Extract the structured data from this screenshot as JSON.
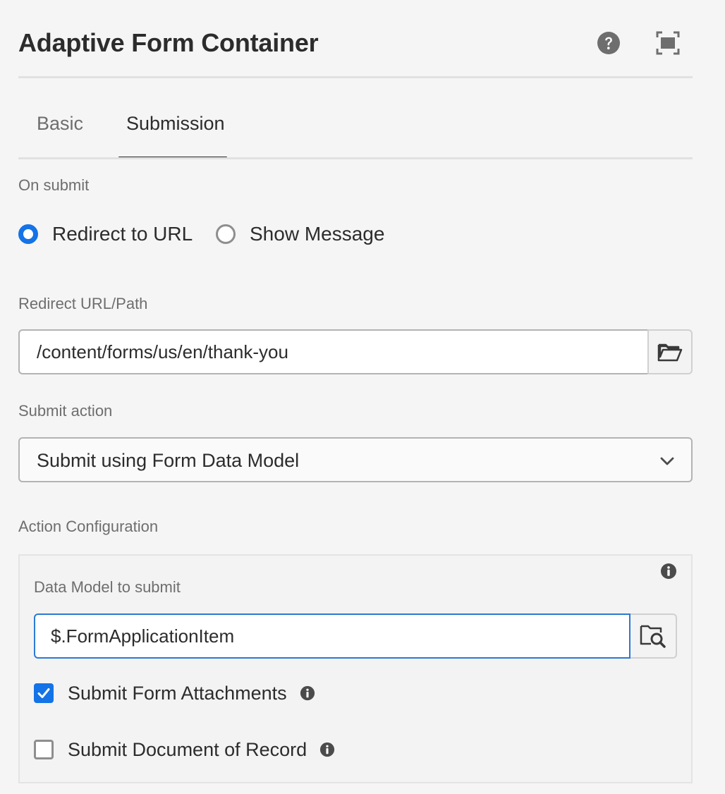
{
  "header": {
    "title": "Adaptive Form Container"
  },
  "tabs": [
    {
      "label": "Basic",
      "active": false
    },
    {
      "label": "Submission",
      "active": true
    }
  ],
  "on_submit": {
    "label": "On submit",
    "options": [
      {
        "label": "Redirect to URL",
        "selected": true
      },
      {
        "label": "Show Message",
        "selected": false
      }
    ]
  },
  "redirect": {
    "label": "Redirect URL/Path",
    "value": "/content/forms/us/en/thank-you"
  },
  "submit_action": {
    "label": "Submit action",
    "selected": "Submit using Form Data Model"
  },
  "action_config": {
    "label": "Action Configuration",
    "data_model_label": "Data Model to submit",
    "data_model_value": "$.FormApplicationItem",
    "checkboxes": [
      {
        "label": "Submit Form Attachments",
        "checked": true
      },
      {
        "label": "Submit Document of Record",
        "checked": false
      }
    ]
  },
  "colors": {
    "accent": "#1473e6",
    "focus_border": "#2b7ad3",
    "icon": "#6e6e6e"
  },
  "icons": {
    "help": "help-icon",
    "fullscreen": "fullscreen-icon",
    "browse": "folder-icon",
    "browse_search": "folder-search-icon",
    "info": "info-icon",
    "dropdown": "chevron-down-icon"
  }
}
